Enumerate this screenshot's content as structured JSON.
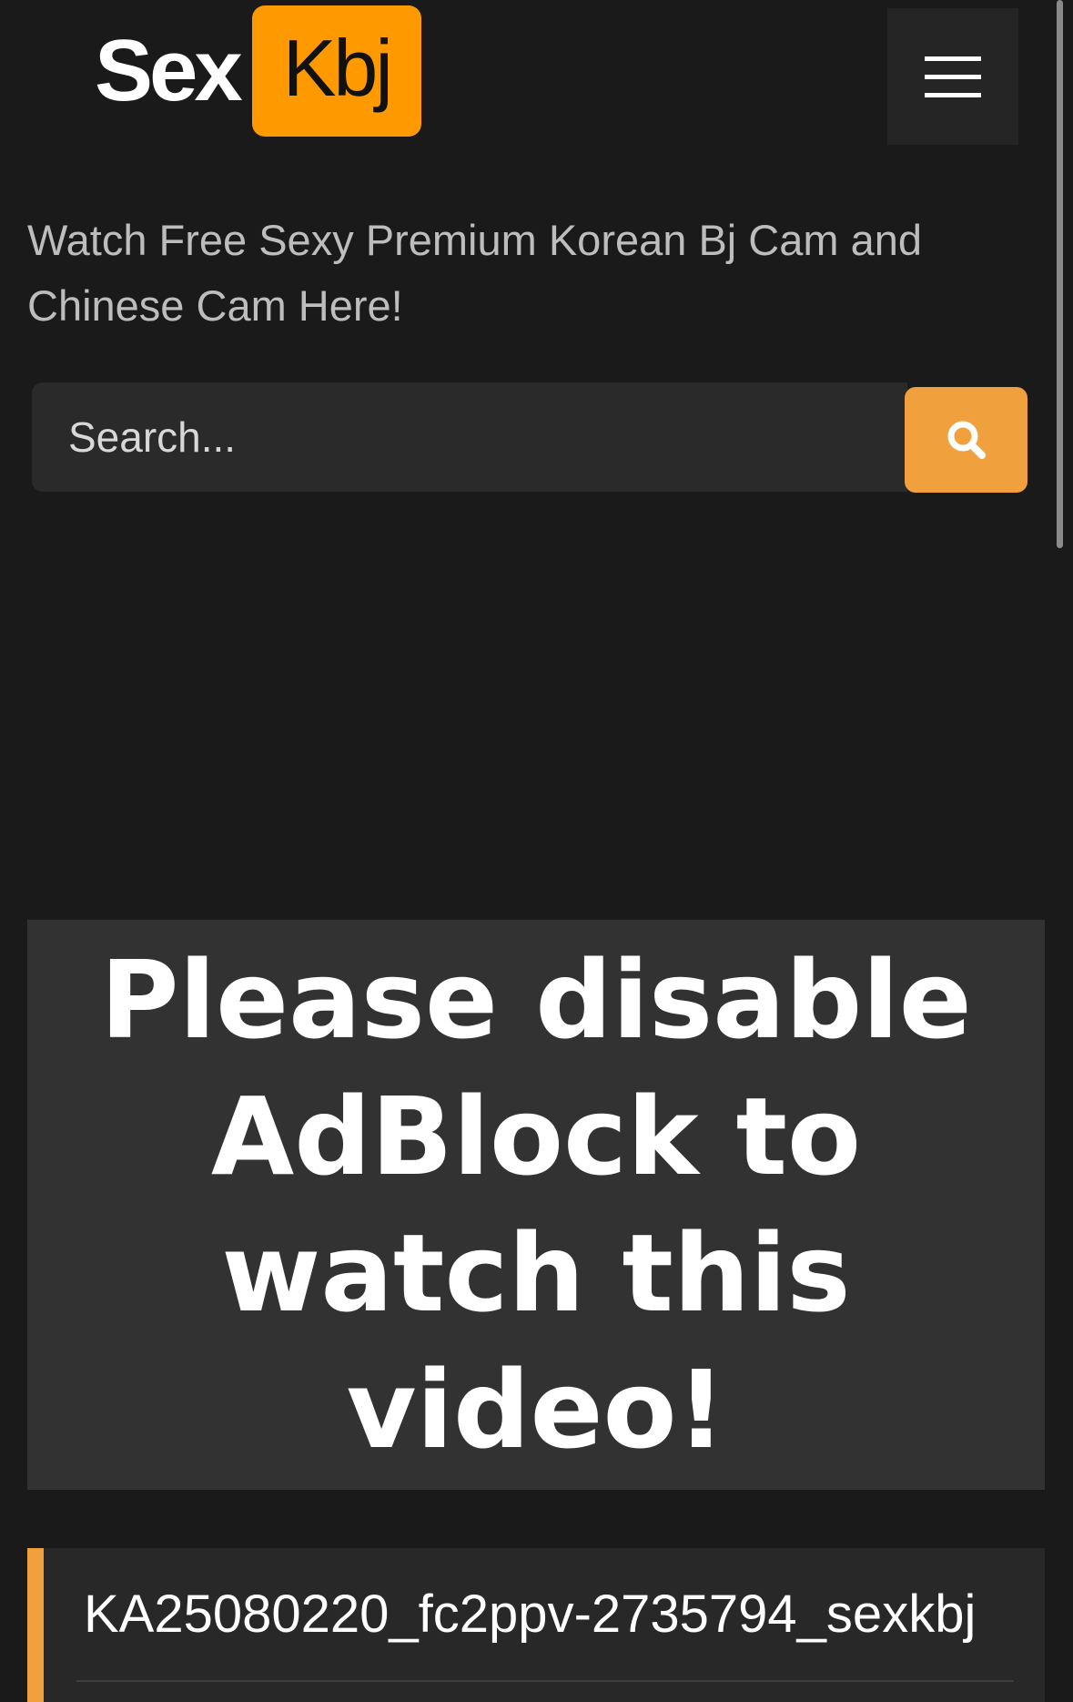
{
  "logo": {
    "part1": "Sex",
    "part2": "Kbj"
  },
  "header": {
    "menu_icon": "hamburger-menu-icon"
  },
  "tagline": "Watch Free Sexy Premium Korean Bj Cam and Chinese Cam Here!",
  "search": {
    "placeholder": "Search...",
    "value": "",
    "button_icon": "search-icon"
  },
  "player": {
    "message": "Please disable AdBlock to watch this video!"
  },
  "video": {
    "title": "KA25080220_fc2ppv-2735794_sexkbj"
  },
  "colors": {
    "background": "#1a1a1a",
    "accent": "#f0a03c",
    "logo_accent": "#ff9900"
  }
}
